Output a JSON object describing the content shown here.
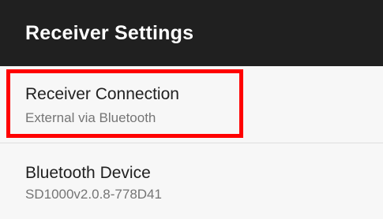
{
  "app_bar": {
    "title": "Receiver Settings"
  },
  "preferences": [
    {
      "title": "Receiver Connection",
      "summary": "External via Bluetooth"
    },
    {
      "title": "Bluetooth Device",
      "summary": "SD1000v2.0.8-778D41"
    }
  ],
  "colors": {
    "app_bar_background": "#202020",
    "screen_background": "#f7f7f7",
    "title_text": "#212121",
    "summary_text": "#757575",
    "highlight_border": "#ff0000"
  }
}
